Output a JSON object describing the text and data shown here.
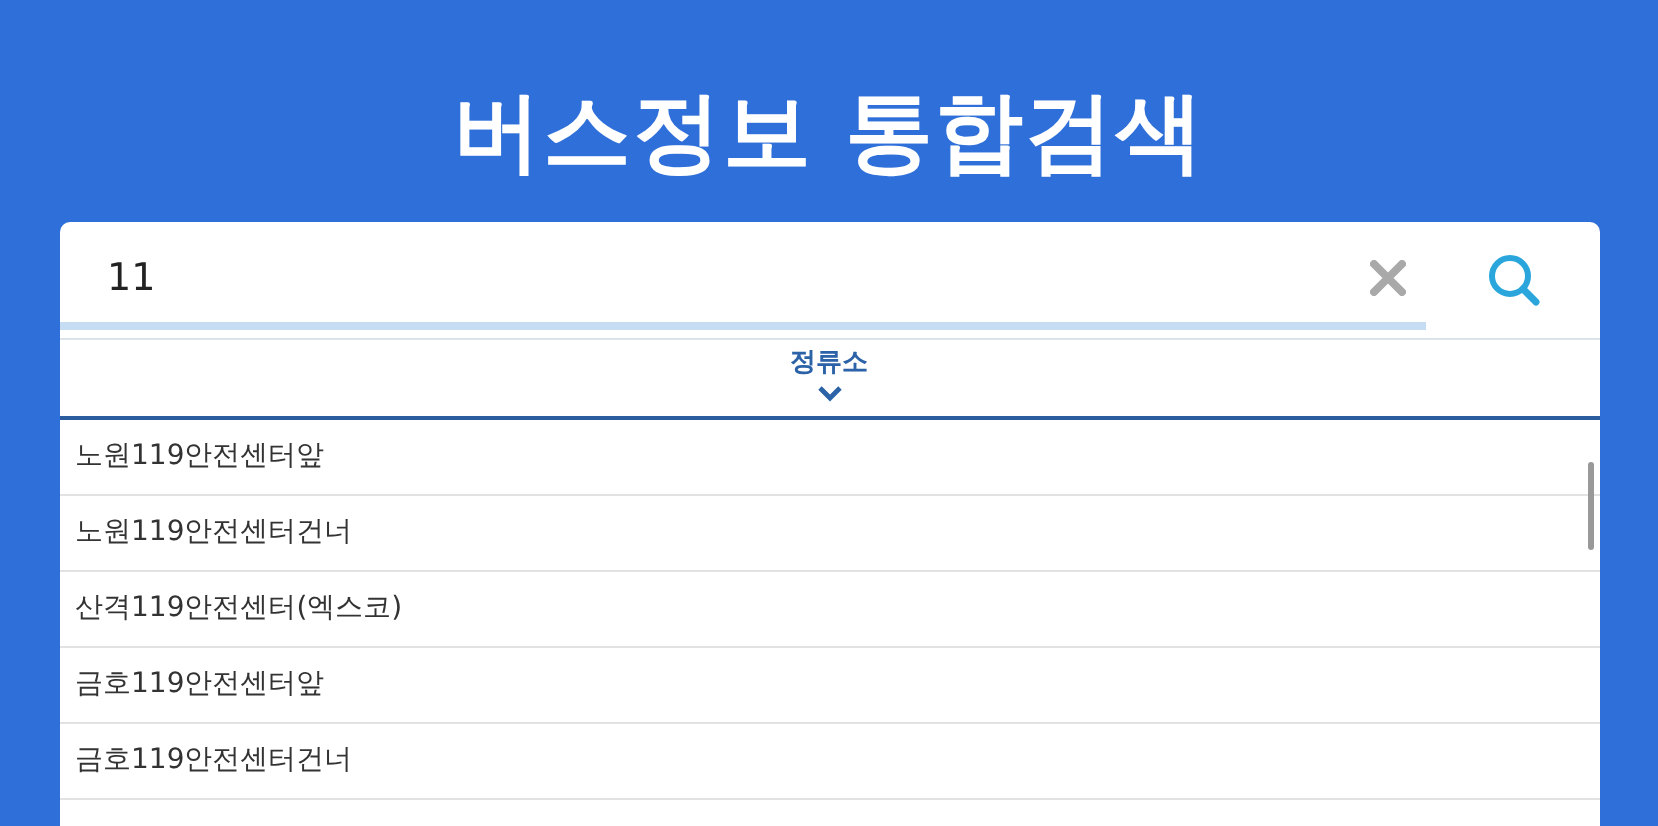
{
  "title": "버스정보 통합검색",
  "search": {
    "value": "11"
  },
  "tabs": [
    {
      "label": "정류소",
      "selected": true
    }
  ],
  "results": [
    {
      "name": "노원119안전센터앞"
    },
    {
      "name": "노원119안전센터건너"
    },
    {
      "name": "산격119안전센터(엑스코)"
    },
    {
      "name": "금호119안전센터앞"
    },
    {
      "name": "금호119안전센터건너"
    }
  ]
}
